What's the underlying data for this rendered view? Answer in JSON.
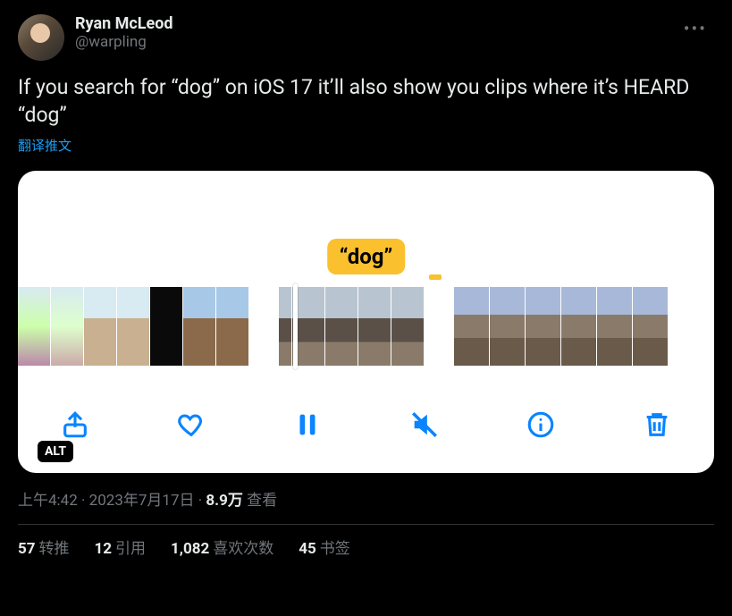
{
  "author": {
    "display_name": "Ryan McLeod",
    "handle": "@warpling"
  },
  "tweet_text": "If you search for “dog” on iOS 17 it’ll also show you clips where it’s HEARD “dog”",
  "translate_label": "翻译推文",
  "media": {
    "caption": "“dog”",
    "alt_badge": "ALT"
  },
  "meta": {
    "time": "上午4:42",
    "date": "2023年7月17日",
    "separator": " · ",
    "views_count": "8.9万",
    "views_label": " 查看"
  },
  "stats": {
    "retweets_count": "57",
    "retweets_label": "转推",
    "quotes_count": "12",
    "quotes_label": "引用",
    "likes_count": "1,082",
    "likes_label": "喜欢次数",
    "bookmarks_count": "45",
    "bookmarks_label": "书签"
  }
}
